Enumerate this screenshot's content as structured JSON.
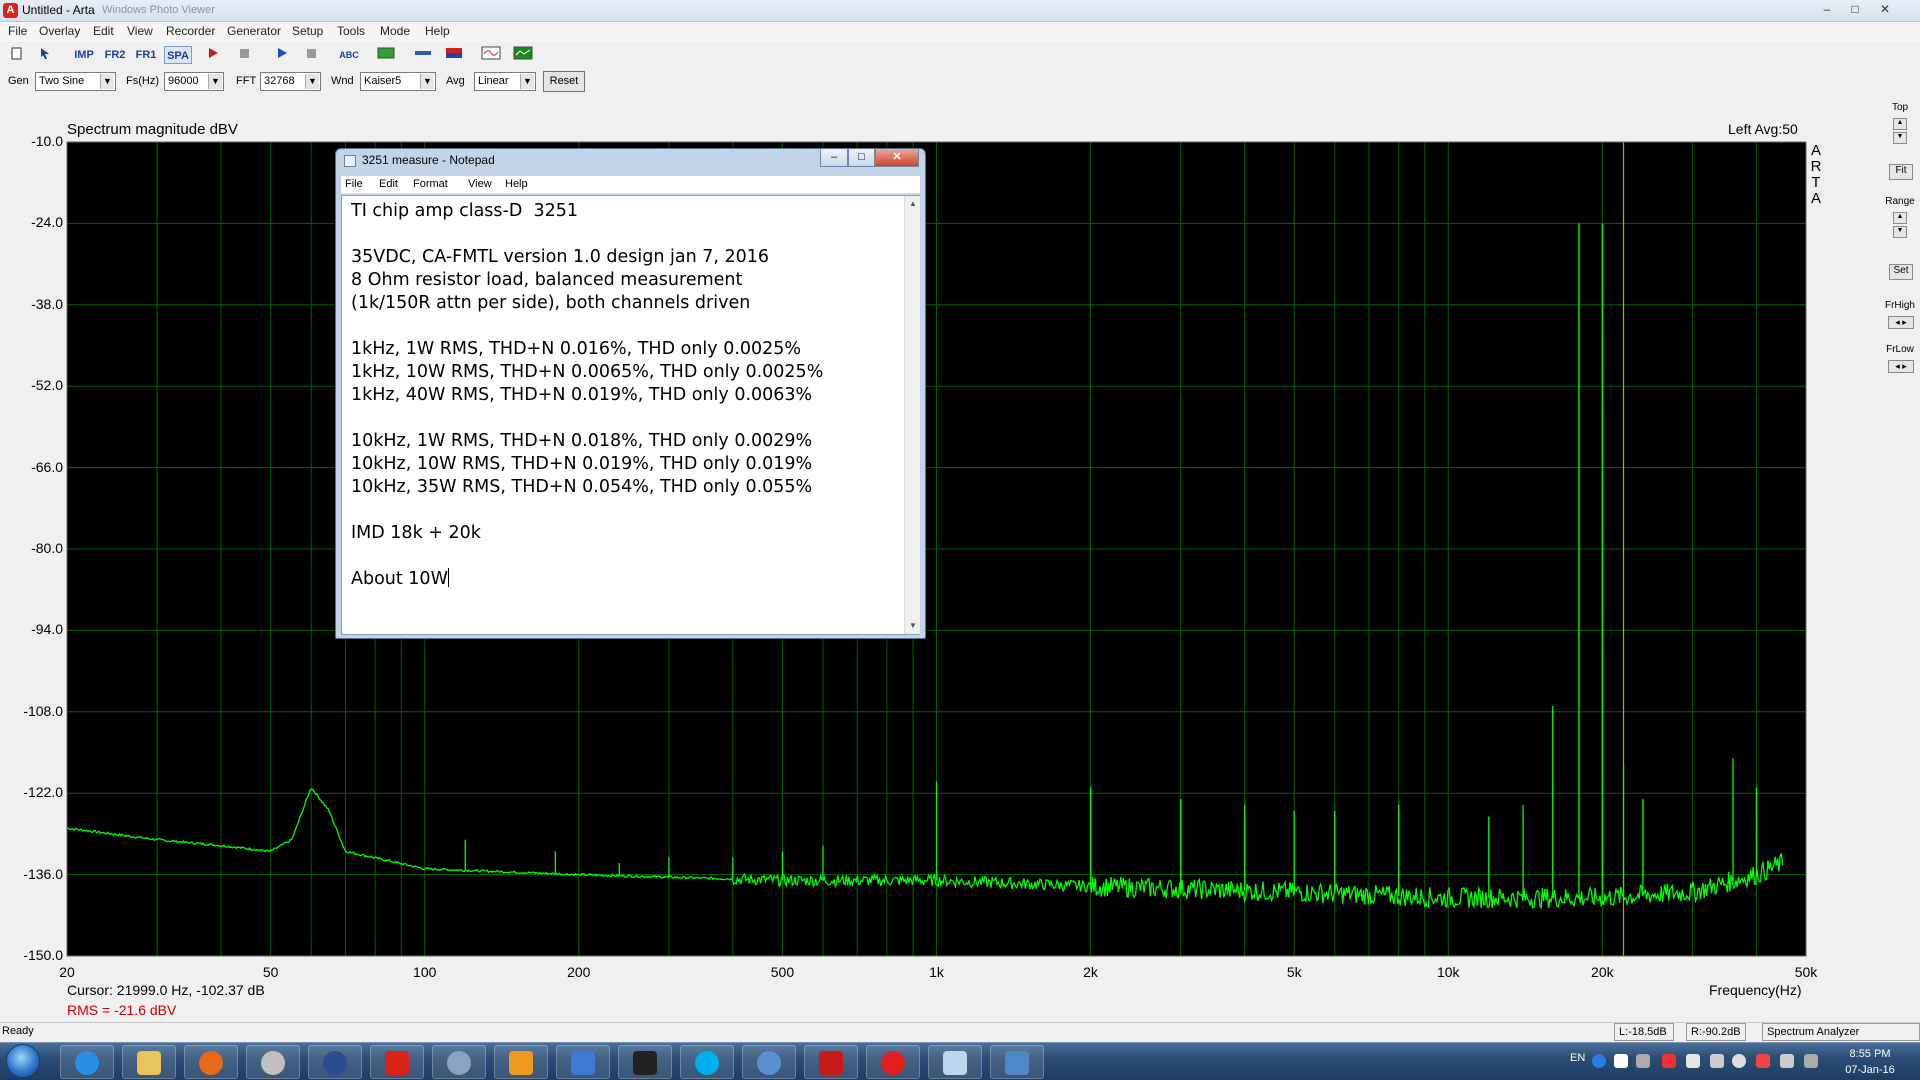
{
  "window": {
    "title": "Untitled - Arta",
    "subtitle": "Windows Photo Viewer",
    "min": "–",
    "max": "□",
    "close": "✕"
  },
  "menu": [
    "File",
    "Overlay",
    "Edit",
    "View",
    "Recorder",
    "Generator",
    "Setup",
    "Tools",
    "Mode",
    "Help"
  ],
  "toolbar": {
    "imp": "IMP",
    "fr2": "FR2",
    "fr1": "FR1",
    "spa": "SPA",
    "abc": "ABC"
  },
  "params": {
    "gen_label": "Gen",
    "gen_value": "Two Sine",
    "fs_label": "Fs(Hz)",
    "fs_value": "96000",
    "fft_label": "FFT",
    "fft_value": "32768",
    "wnd_label": "Wnd",
    "wnd_value": "Kaiser5",
    "avg_label": "Avg",
    "avg_value": "Linear",
    "reset": "Reset"
  },
  "plot": {
    "y_unit": "Spectrum magnitude dBV",
    "channel_avg": "Left  Avg:50",
    "side_brand": "ARTA",
    "x_unit": "Frequency(Hz)",
    "cursor": "Cursor: 21999.0 Hz, -102.37 dB",
    "rms": "RMS =  -21.6 dBV",
    "y_ticks": [
      "-10.0",
      "-24.0",
      "-38.0",
      "-52.0",
      "-66.0",
      "-80.0",
      "-94.0",
      "-108.0",
      "-122.0",
      "-136.0",
      "-150.0"
    ],
    "x_ticks": [
      {
        "label": "20",
        "f": 20
      },
      {
        "label": "50",
        "f": 50
      },
      {
        "label": "100",
        "f": 100
      },
      {
        "label": "200",
        "f": 200
      },
      {
        "label": "500",
        "f": 500
      },
      {
        "label": "1k",
        "f": 1000
      },
      {
        "label": "2k",
        "f": 2000
      },
      {
        "label": "5k",
        "f": 5000
      },
      {
        "label": "10k",
        "f": 10000
      },
      {
        "label": "20k",
        "f": 20000
      },
      {
        "label": "50k",
        "f": 50000
      }
    ],
    "colors": {
      "background": "#000000",
      "grid": "#006400",
      "trace": "#00ff00",
      "cursor": "#c8a000"
    }
  },
  "chart_data": {
    "type": "line",
    "title": "",
    "xlabel": "Frequency(Hz)",
    "ylabel": "Spectrum magnitude dBV",
    "xscale": "log",
    "xlim": [
      20,
      50000
    ],
    "ylim": [
      -150,
      -10
    ],
    "cursor_hz": 21999,
    "noise_floor": [
      [
        20,
        -128
      ],
      [
        30,
        -130
      ],
      [
        40,
        -131
      ],
      [
        50,
        -132
      ],
      [
        55,
        -130
      ],
      [
        60,
        -121
      ],
      [
        65,
        -125
      ],
      [
        70,
        -132
      ],
      [
        100,
        -135
      ],
      [
        200,
        -136
      ],
      [
        500,
        -137
      ],
      [
        1000,
        -137
      ],
      [
        2000,
        -138
      ],
      [
        5000,
        -139
      ],
      [
        10000,
        -140
      ],
      [
        20000,
        -140
      ],
      [
        30000,
        -139
      ],
      [
        40000,
        -136
      ],
      [
        45000,
        -134
      ]
    ],
    "peaks": [
      [
        60,
        -121
      ],
      [
        120,
        -130
      ],
      [
        180,
        -132
      ],
      [
        240,
        -134
      ],
      [
        300,
        -133
      ],
      [
        400,
        -133
      ],
      [
        500,
        -132
      ],
      [
        600,
        -131
      ],
      [
        1000,
        -120
      ],
      [
        2000,
        -121
      ],
      [
        3000,
        -123
      ],
      [
        4000,
        -124
      ],
      [
        5000,
        -125
      ],
      [
        6000,
        -125
      ],
      [
        8000,
        -124
      ],
      [
        12000,
        -126
      ],
      [
        14000,
        -124
      ],
      [
        16000,
        -107
      ],
      [
        18000,
        -24
      ],
      [
        20000,
        -24
      ],
      [
        22000,
        -117
      ],
      [
        24000,
        -123
      ],
      [
        36000,
        -116
      ],
      [
        40000,
        -121
      ]
    ]
  },
  "right_panel": {
    "top": "Top",
    "fit": "Fit",
    "range": "Range",
    "set": "Set",
    "frhigh": "FrHigh",
    "frlow": "FrLow",
    "up": "▲",
    "down": "▼",
    "lr": "◂ ▸"
  },
  "status": {
    "ready": "Ready",
    "l_db": "L:-18.5dB",
    "r_db": "R:-90.2dB",
    "mode": "Spectrum Analyzer"
  },
  "taskbar": {
    "lang": "EN",
    "time": "8:55 PM",
    "date": "07-Jan-16"
  },
  "notepad": {
    "title": "3251 measure - Notepad",
    "menu": [
      "File",
      "Edit",
      "Format",
      "View",
      "Help"
    ],
    "text": "TI chip amp class-D  3251\n\n35VDC, CA-FMTL version 1.0 design jan 7, 2016\n8 Ohm resistor load, balanced measurement\n(1k/150R attn per side), both channels driven\n\n1kHz, 1W RMS, THD+N 0.016%, THD only 0.0025%\n1kHz, 10W RMS, THD+N 0.0065%, THD only 0.0025%\n1kHz, 40W RMS, THD+N 0.019%, THD only 0.0063%\n\n10kHz, 1W RMS, THD+N 0.018%, THD only 0.0029%\n10kHz, 10W RMS, THD+N 0.019%, THD only 0.019%\n10kHz, 35W RMS, THD+N 0.054%, THD only 0.055%\n\nIMD 18k + 20k\n\nAbout 10W"
  }
}
